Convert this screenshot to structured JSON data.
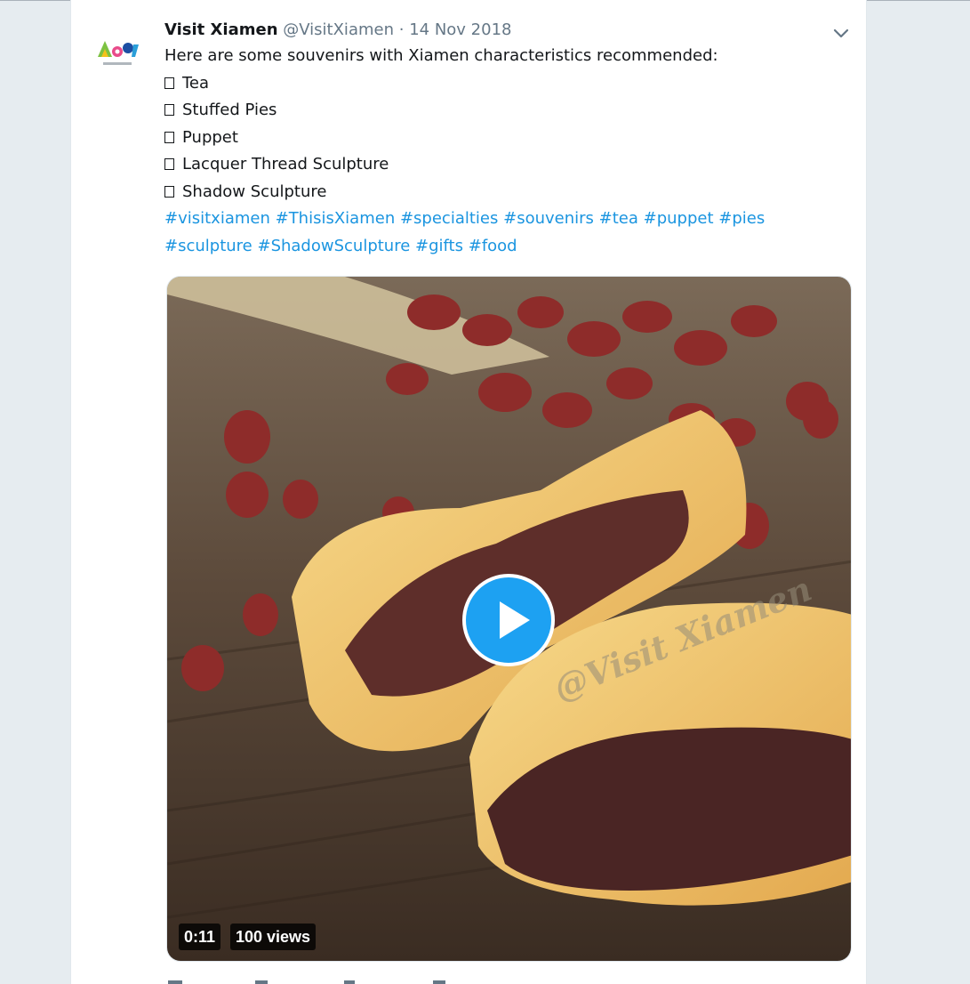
{
  "tweet": {
    "author": {
      "name": "Visit Xiamen",
      "handle": "@VisitXiamen",
      "separator": "·",
      "date": "14 Nov 2018",
      "avatar_logo_text": "Amoy"
    },
    "intro": "Here are some souvenirs with Xiamen characteristics recommended:",
    "items": [
      "Tea",
      "Stuffed Pies",
      "Puppet",
      "Lacquer Thread Sculpture",
      "Shadow Sculpture"
    ],
    "hashtags_line1": [
      "#visitxiamen",
      "#ThisisXiamen",
      "#specialties",
      "#souvenirs",
      "#tea",
      "#puppet",
      "#pies"
    ],
    "hashtags_line2": [
      "#sculpture",
      "#ShadowSculpture",
      "#gifts",
      "#food"
    ],
    "video": {
      "duration": "0:11",
      "views": "100 views",
      "watermark": "@Visit Xiamen"
    }
  },
  "colors": {
    "page_bg": "#e6ecf0",
    "link": "#1b95e0",
    "play_button": "#1da1f2",
    "muted_text": "#657786"
  },
  "icons": {
    "menu": "chevron-down-icon",
    "play": "play-icon",
    "item_marker": "box-glyph"
  }
}
